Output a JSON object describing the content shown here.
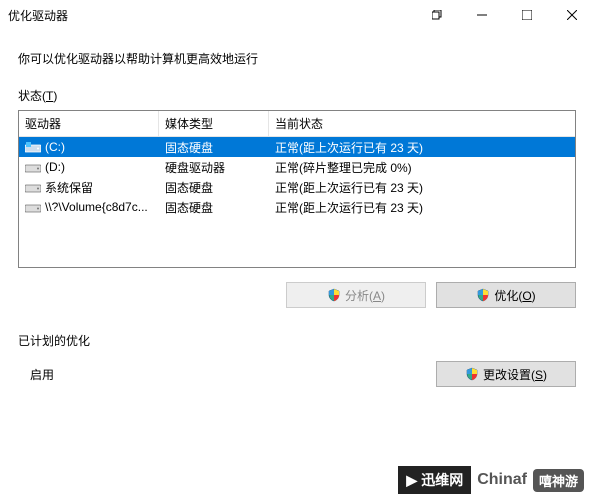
{
  "window": {
    "title": "优化驱动器"
  },
  "description": "你可以优化驱动器以帮助计算机更高效地运行",
  "status_label": "状态(",
  "status_label_u": "T",
  "status_label_end": ")",
  "table": {
    "headers": {
      "drive": "驱动器",
      "media": "媒体类型",
      "status": "当前状态"
    },
    "rows": [
      {
        "icon": "ssd-win",
        "drive": "(C:)",
        "media": "固态硬盘",
        "status": "正常(距上次运行已有 23 天)",
        "selected": true
      },
      {
        "icon": "hdd",
        "drive": "(D:)",
        "media": "硬盘驱动器",
        "status": "正常(碎片整理已完成 0%)",
        "selected": false
      },
      {
        "icon": "ssd",
        "drive": "系统保留",
        "media": "固态硬盘",
        "status": "正常(距上次运行已有 23 天)",
        "selected": false
      },
      {
        "icon": "ssd",
        "drive": "\\\\?\\Volume{c8d7c...",
        "media": "固态硬盘",
        "status": "正常(距上次运行已有 23 天)",
        "selected": false
      }
    ]
  },
  "buttons": {
    "analyze": "分析(",
    "analyze_u": "A",
    "analyze_end": ")",
    "optimize": "优化(",
    "optimize_u": "O",
    "optimize_end": ")",
    "change": "更改设置(",
    "change_u": "S",
    "change_end": ")"
  },
  "schedule": {
    "title": "已计划的优化",
    "enable": "启用"
  },
  "watermark": {
    "brand": "迅维网",
    "text": "Chinaf",
    "tag": "嘻神游"
  }
}
